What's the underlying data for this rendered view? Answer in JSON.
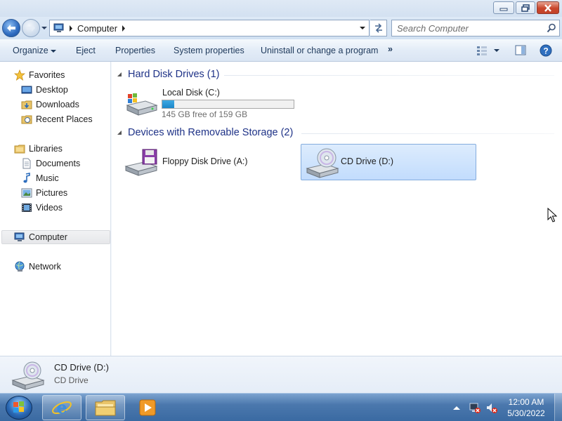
{
  "address_bar": {
    "crumbs": [
      "Computer"
    ],
    "refresh_label": "Refresh"
  },
  "search": {
    "placeholder": "Search Computer"
  },
  "toolbar": {
    "organize": "Organize",
    "eject": "Eject",
    "properties": "Properties",
    "system_properties": "System properties",
    "uninstall": "Uninstall or change a program",
    "more": "»"
  },
  "nav": {
    "favorites": "Favorites",
    "desktop": "Desktop",
    "downloads": "Downloads",
    "recent_places": "Recent Places",
    "libraries": "Libraries",
    "documents": "Documents",
    "music": "Music",
    "pictures": "Pictures",
    "videos": "Videos",
    "computer": "Computer",
    "network": "Network"
  },
  "groups": {
    "hard_disk_drives": "Hard Disk Drives (1)",
    "removable_storage": "Devices with Removable Storage (2)"
  },
  "drives": {
    "local_disk": {
      "name": "Local Disk (C:)",
      "free_text": "145 GB free of 159 GB",
      "used_fraction": 0.09
    },
    "floppy": {
      "name": "Floppy Disk Drive (A:)"
    },
    "cd": {
      "name": "CD Drive (D:)"
    }
  },
  "details": {
    "name": "CD Drive (D:)",
    "type": "CD Drive"
  },
  "taskbar": {
    "time": "12:00 AM",
    "date": "5/30/2022"
  },
  "colors": {
    "accent": "#1e3287",
    "selection": "#c2dcfd",
    "progress": "#1c87c9"
  }
}
